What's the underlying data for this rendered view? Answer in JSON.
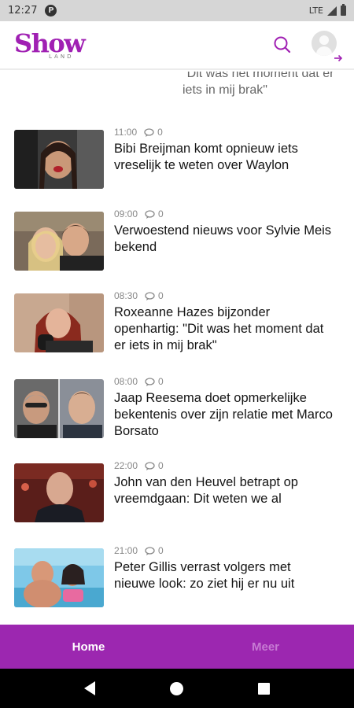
{
  "status_bar": {
    "time": "12:27",
    "network": "LTE"
  },
  "header": {
    "logo_main": "Show",
    "logo_sub": "LAND",
    "brand_color": "#a020b3",
    "search_icon": "search-icon",
    "account_icon": "account-login-icon"
  },
  "feed": {
    "snippet": "\"Dit was het moment dat er iets in mij brak\"",
    "articles": [
      {
        "time": "11:00",
        "comments": "0",
        "title": "Bibi Breijman komt opnieuw iets vreselijk te weten over Waylon"
      },
      {
        "time": "09:00",
        "comments": "0",
        "title": "Verwoestend nieuws voor Sylvie Meis bekend"
      },
      {
        "time": "08:30",
        "comments": "0",
        "title": "Roxeanne Hazes bijzonder openhartig: \"Dit was het moment dat er iets in mij brak\""
      },
      {
        "time": "08:00",
        "comments": "0",
        "title": "Jaap Reesema doet opmerkelijke bekentenis over zijn relatie met Marco Borsato"
      },
      {
        "time": "22:00",
        "comments": "0",
        "title": "John van den Heuvel betrapt op vreemdgaan: Dit weten we al"
      },
      {
        "time": "21:00",
        "comments": "0",
        "title": "Peter Gillis verrast volgers met nieuwe look: zo ziet hij er nu uit"
      }
    ]
  },
  "bottom_nav": {
    "tabs": [
      {
        "label": "Home",
        "active": true
      },
      {
        "label": "Meer",
        "active": false
      }
    ],
    "bar_color": "#9c27b0"
  }
}
